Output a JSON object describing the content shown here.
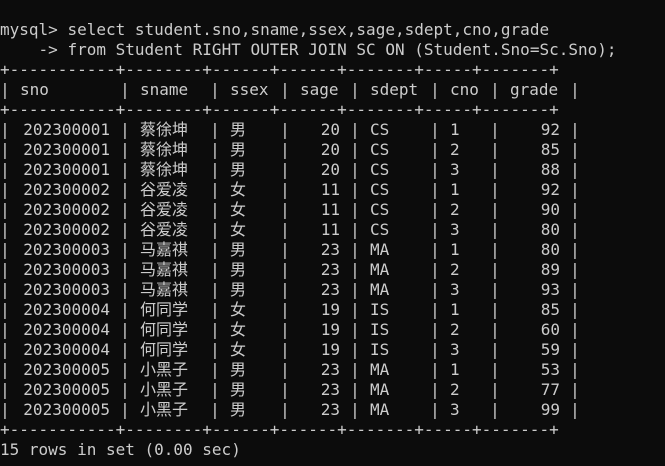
{
  "prompt": {
    "primary": "mysql>",
    "continuation": "->"
  },
  "query": {
    "line1": "select student.sno,sname,ssex,sage,sdept,cno,grade",
    "line2": "from Student RIGHT OUTER JOIN SC ON (Student.Sno=Sc.Sno);"
  },
  "table": {
    "columns": [
      "sno",
      "sname",
      "ssex",
      "sage",
      "sdept",
      "cno",
      "grade"
    ],
    "rows": [
      [
        "202300001",
        "蔡徐坤",
        "男",
        "20",
        "CS",
        "1",
        "92"
      ],
      [
        "202300001",
        "蔡徐坤",
        "男",
        "20",
        "CS",
        "2",
        "85"
      ],
      [
        "202300001",
        "蔡徐坤",
        "男",
        "20",
        "CS",
        "3",
        "88"
      ],
      [
        "202300002",
        "谷爱凌",
        "女",
        "11",
        "CS",
        "1",
        "92"
      ],
      [
        "202300002",
        "谷爱凌",
        "女",
        "11",
        "CS",
        "2",
        "90"
      ],
      [
        "202300002",
        "谷爱凌",
        "女",
        "11",
        "CS",
        "3",
        "80"
      ],
      [
        "202300003",
        "马嘉祺",
        "男",
        "23",
        "MA",
        "1",
        "80"
      ],
      [
        "202300003",
        "马嘉祺",
        "男",
        "23",
        "MA",
        "2",
        "89"
      ],
      [
        "202300003",
        "马嘉祺",
        "男",
        "23",
        "MA",
        "3",
        "93"
      ],
      [
        "202300004",
        "何同学",
        "女",
        "19",
        "IS",
        "1",
        "85"
      ],
      [
        "202300004",
        "何同学",
        "女",
        "19",
        "IS",
        "2",
        "60"
      ],
      [
        "202300004",
        "何同学",
        "女",
        "19",
        "IS",
        "3",
        "59"
      ],
      [
        "202300005",
        "小黑子",
        "男",
        "23",
        "MA",
        "1",
        "53"
      ],
      [
        "202300005",
        "小黑子",
        "男",
        "23",
        "MA",
        "2",
        "77"
      ],
      [
        "202300005",
        "小黑子",
        "男",
        "23",
        "MA",
        "3",
        "99"
      ]
    ]
  },
  "footer": {
    "summary": "15 rows in set (0.00 sec)"
  },
  "colors": {
    "background": "#0c0c0c",
    "text": "#cccccc"
  }
}
